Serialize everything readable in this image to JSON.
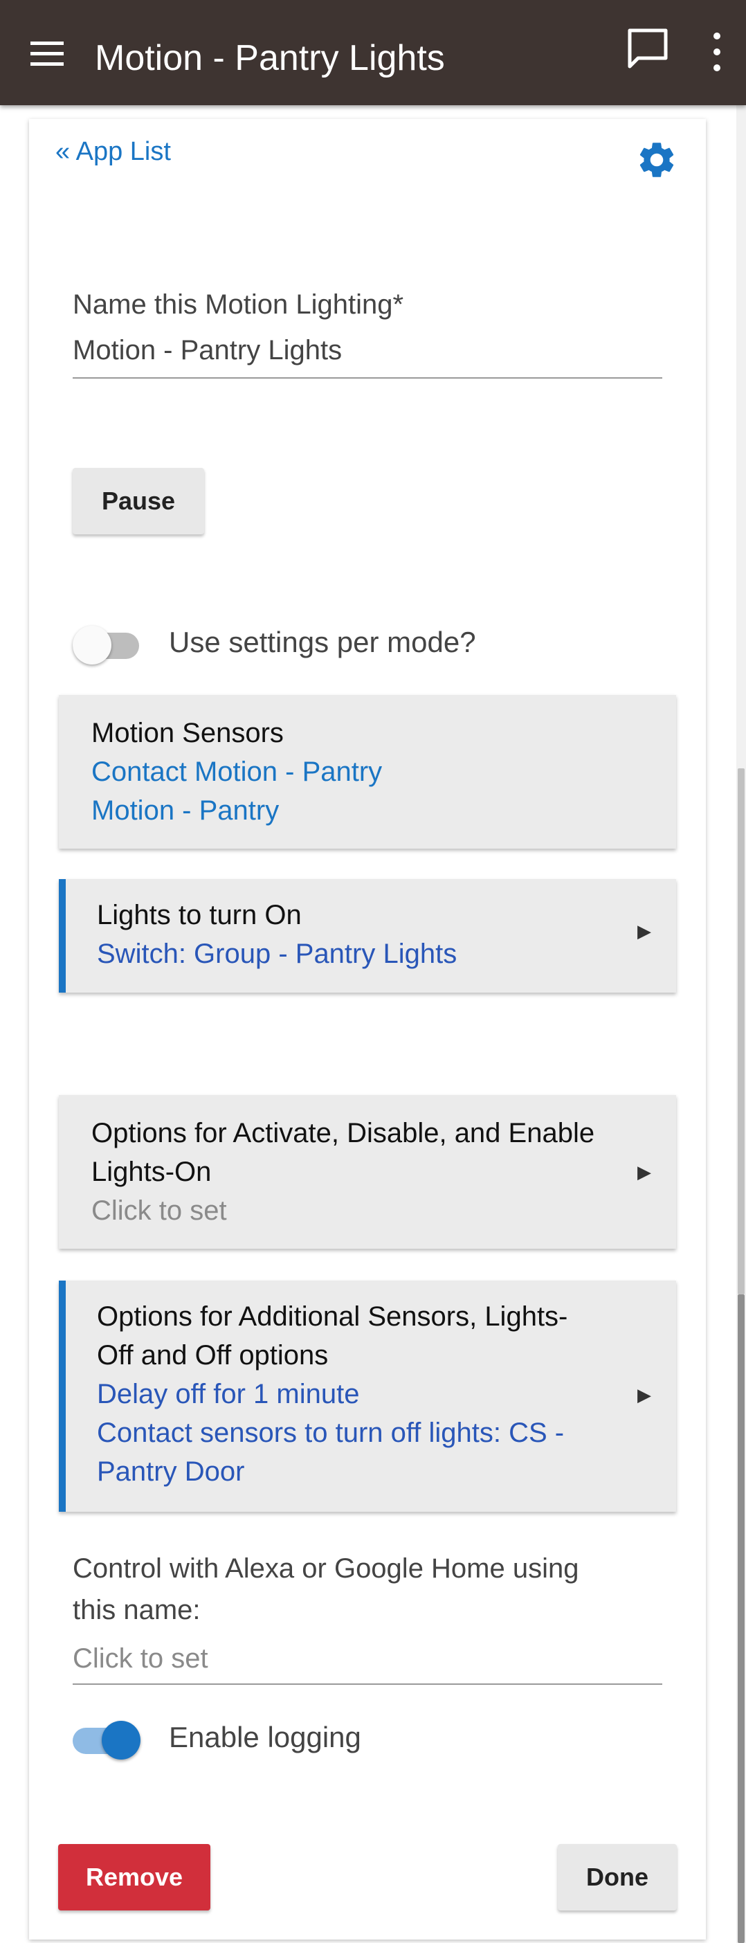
{
  "appbar": {
    "title": "Motion - Pantry Lights",
    "menu_icon": "hamburger-menu-icon",
    "chat_icon": "chat-bubble-icon",
    "more_icon": "vertical-dots-icon"
  },
  "nav": {
    "app_list_link": "« App List",
    "settings_icon": "gear-icon"
  },
  "name_field": {
    "label": "Name this Motion Lighting*",
    "value": "Motion - Pantry Lights"
  },
  "pause_button": "Pause",
  "mode_toggle": {
    "label": "Use settings per mode?",
    "checked": false
  },
  "motion_sensors": {
    "title": "Motion Sensors",
    "items": [
      "Contact Motion - Pantry",
      "Motion - Pantry"
    ]
  },
  "lights_on": {
    "title": "Lights to turn On",
    "value": "Switch: Group - Pantry Lights"
  },
  "options_activate": {
    "title_line1": "Options for Activate, Disable, and Enable",
    "title_line2": "Lights-On",
    "value": "Click to set"
  },
  "options_additional": {
    "title_line1": "Options for Additional Sensors, Lights-",
    "title_line2": "Off and Off options",
    "value_line1": "Delay off for 1 minute",
    "value_line2": "Contact sensors to turn off lights: CS -",
    "value_line3": "Pantry Door"
  },
  "voice_field": {
    "label_line1": "Control with Alexa or Google Home using",
    "label_line2": "this name:",
    "placeholder": "Click to set"
  },
  "logging_toggle": {
    "label": "Enable logging",
    "checked": true
  },
  "buttons": {
    "remove": "Remove",
    "done": "Done"
  },
  "colors": {
    "appbar": "#3e3431",
    "accent_blue": "#1a75c4",
    "remove_red": "#d12f3b",
    "section_bg": "#ebebeb"
  }
}
